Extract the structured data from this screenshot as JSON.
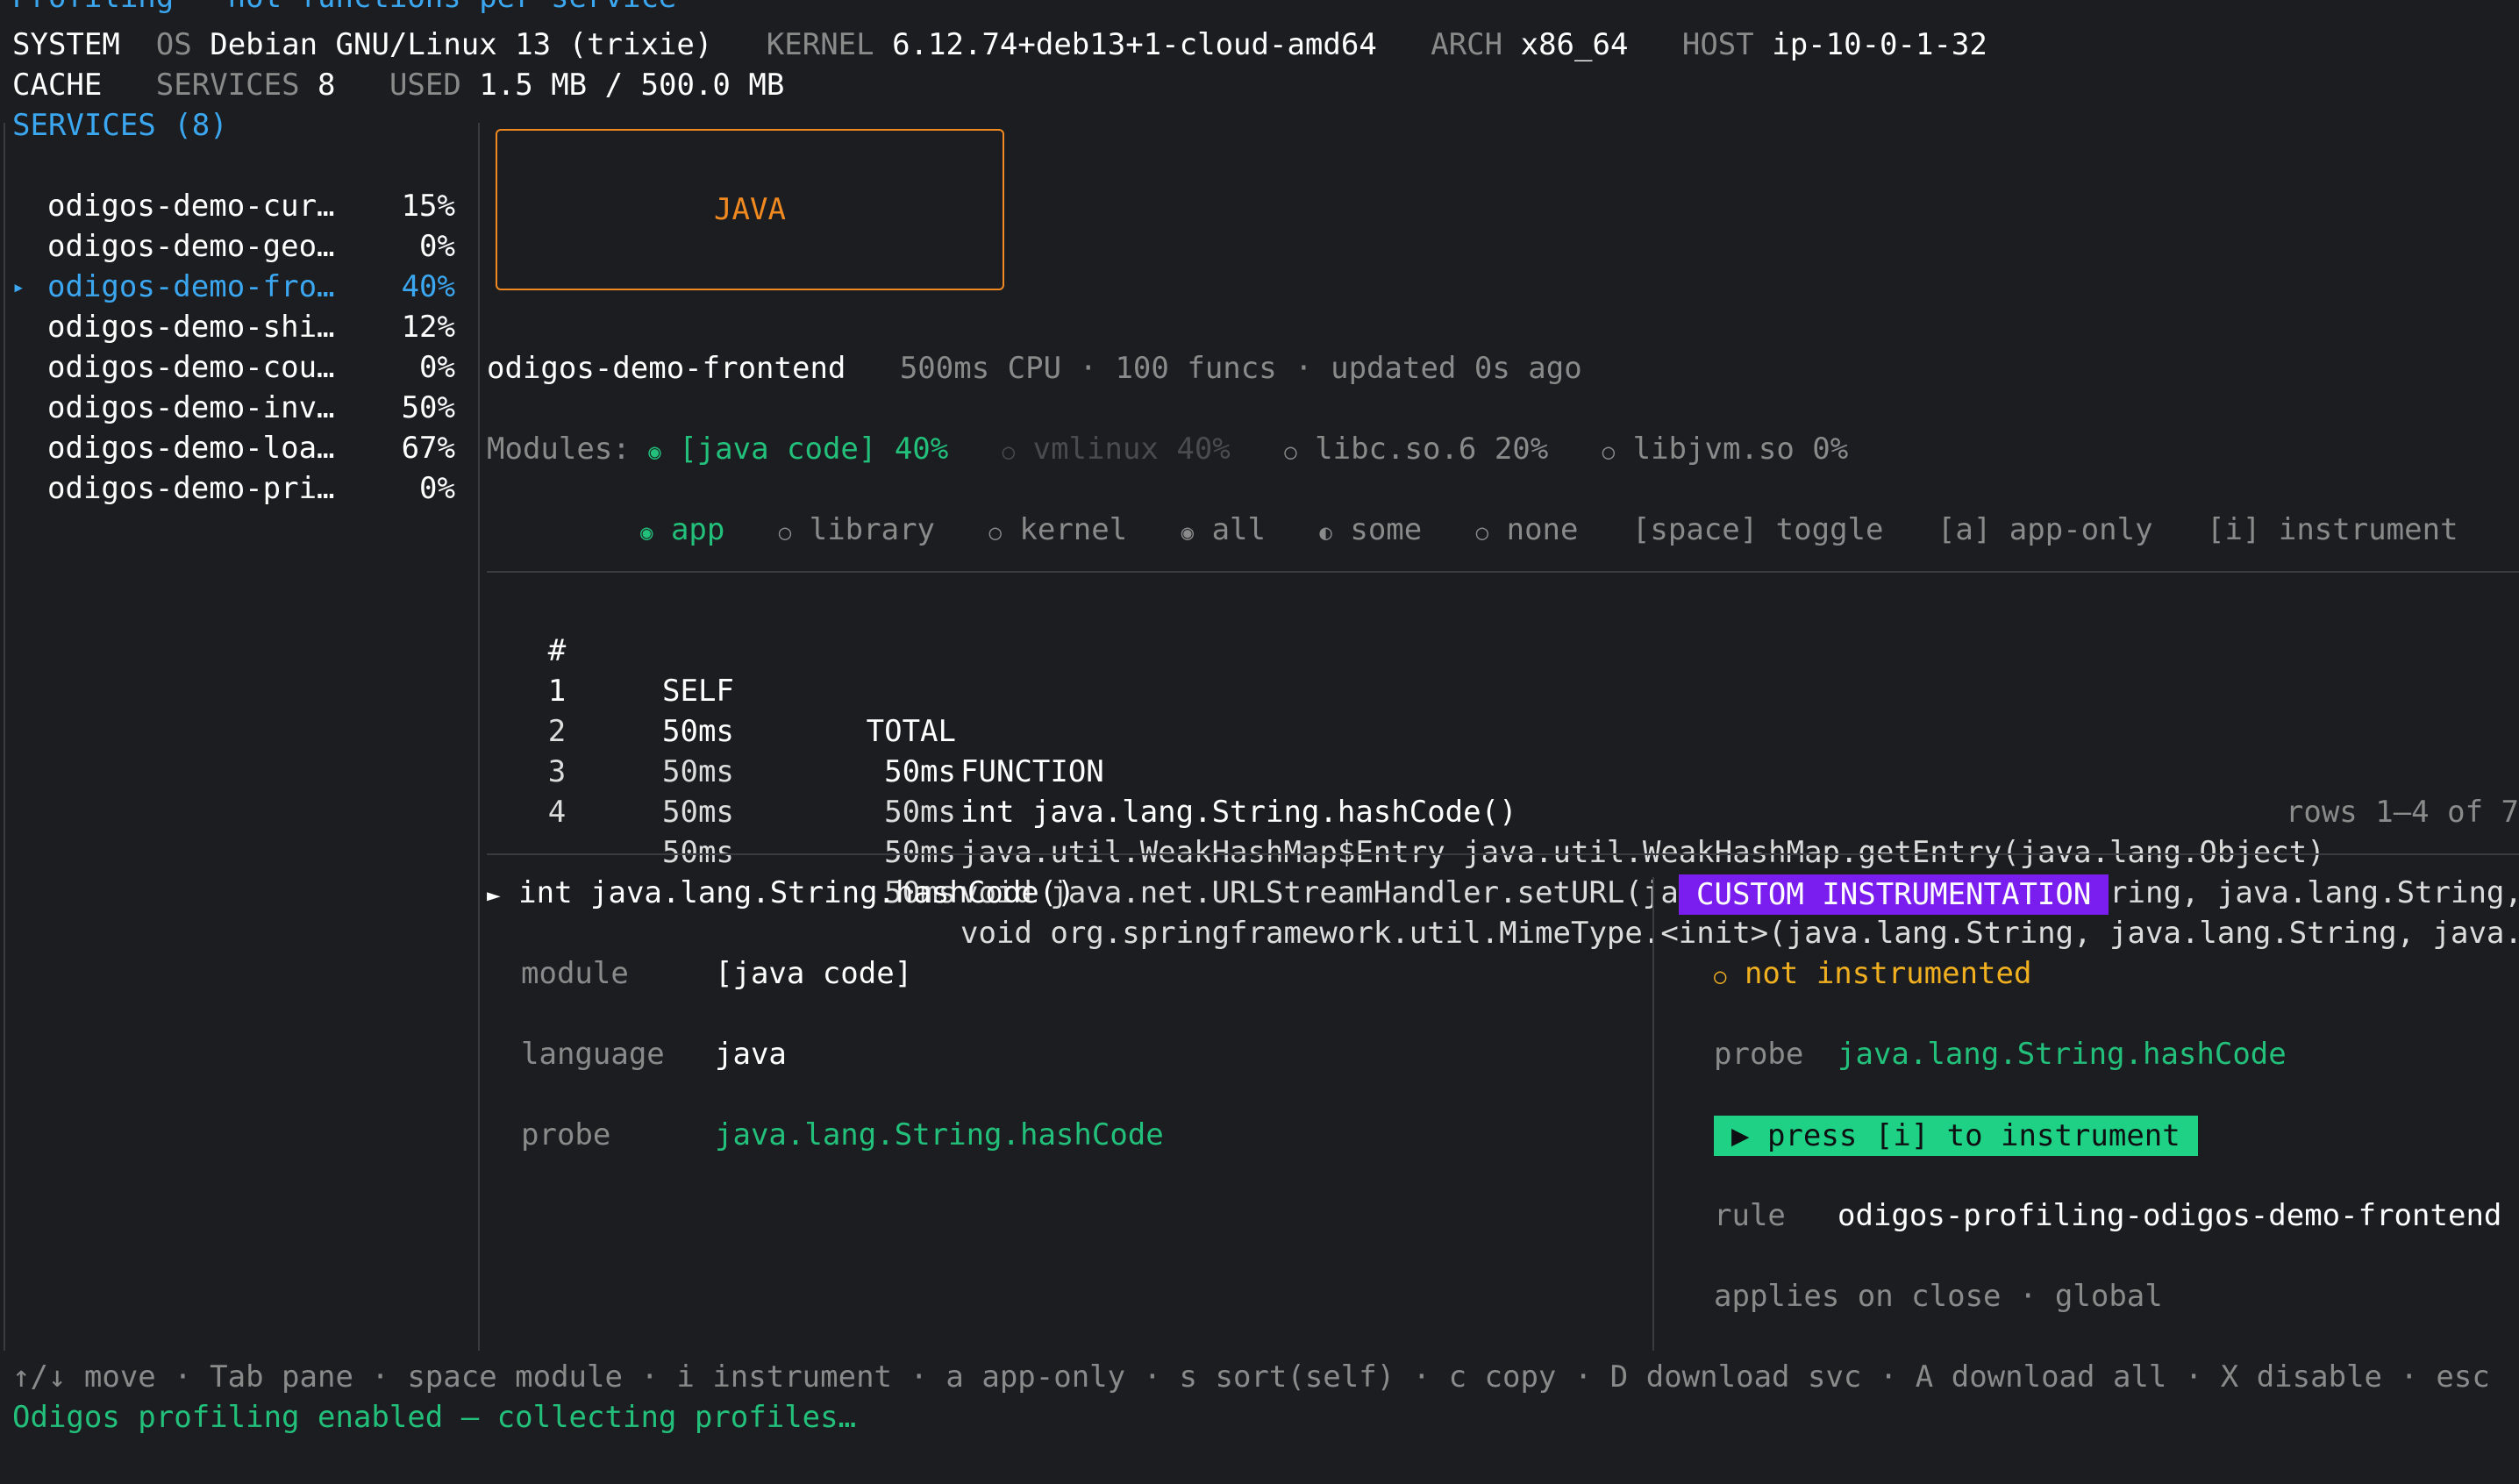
{
  "header": {
    "title_partial": "Profiling · hot functions per service",
    "system_label": "SYSTEM",
    "os_label": "OS",
    "os_value": "Debian GNU/Linux 13 (trixie)",
    "kernel_label": "KERNEL",
    "kernel_value": "6.12.74+deb13+1-cloud-amd64",
    "arch_label": "ARCH",
    "arch_value": "x86_64",
    "host_label": "HOST",
    "host_value": "ip-10-0-1-32",
    "cache_label": "CACHE",
    "services_label": "SERVICES",
    "services_value": "8",
    "used_label": "USED",
    "used_value": "1.5 MB / 500.0 MB"
  },
  "sidebar": {
    "title": "SERVICES (8)",
    "selected_marker": "▸",
    "items": [
      {
        "name": "odigos-demo-cur…",
        "pct": "15%"
      },
      {
        "name": "odigos-demo-geo…",
        "pct": "0%"
      },
      {
        "name": "odigos-demo-fro…",
        "pct": "40%"
      },
      {
        "name": "odigos-demo-shi…",
        "pct": "12%"
      },
      {
        "name": "odigos-demo-cou…",
        "pct": "0%"
      },
      {
        "name": "odigos-demo-inv…",
        "pct": "50%"
      },
      {
        "name": "odigos-demo-loa…",
        "pct": "67%"
      },
      {
        "name": "odigos-demo-pri…",
        "pct": "0%"
      }
    ]
  },
  "language_badge": "JAVA",
  "service": {
    "name": "odigos-demo-frontend",
    "meta": "500ms CPU · 100 funcs · updated 0s ago"
  },
  "modules": {
    "label": "Modules:",
    "items": [
      {
        "icon": "◉",
        "text": "[java code] 40%"
      },
      {
        "icon": "○",
        "text": "vmlinux 40%"
      },
      {
        "icon": "○",
        "text": "libc.so.6 20%"
      },
      {
        "icon": "○",
        "text": "libjvm.so 0%"
      }
    ]
  },
  "filters": {
    "app": {
      "icon": "◉",
      "label": "app"
    },
    "library": {
      "icon": "○",
      "label": "library"
    },
    "kernel": {
      "icon": "○",
      "label": "kernel"
    },
    "all": {
      "icon": "◉",
      "label": "all"
    },
    "some": {
      "icon": "◐",
      "label": "some"
    },
    "none": {
      "icon": "○",
      "label": "none"
    },
    "hint_toggle": "[space] toggle",
    "hint_app_only": "[a] app-only",
    "hint_instrument": "[i] instrument"
  },
  "table": {
    "headers": {
      "num": "#",
      "self": "SELF",
      "total": "TOTAL",
      "function": "FUNCTION"
    },
    "rows": [
      {
        "num": "1",
        "self": "50ms",
        "total": "50ms",
        "function": "int java.lang.String.hashCode()"
      },
      {
        "num": "2",
        "self": "50ms",
        "total": "50ms",
        "function": "java.util.WeakHashMap$Entry java.util.WeakHashMap.getEntry(java.lang.Object)"
      },
      {
        "num": "3",
        "self": "50ms",
        "total": "50ms",
        "function": "void java.net.URLStreamHandler.setURL(java.net.URL, java.lang.String, java.lang.String, …"
      },
      {
        "num": "4",
        "self": "50ms",
        "total": "50ms",
        "function": "void org.springframework.util.MimeType.<init>(java.lang.String, java.lang.String, java.u…"
      }
    ],
    "footer": "rows 1–4 of 7"
  },
  "detail": {
    "marker": "►",
    "title": "int java.lang.String.hashCode()",
    "module_label": "module",
    "module_value": "[java code]",
    "language_label": "language",
    "language_value": "java",
    "probe_label": "probe",
    "probe_value": "java.lang.String.hashCode"
  },
  "instrumentation": {
    "title": "CUSTOM INSTRUMENTATION",
    "status_icon": "○",
    "status": "not instrumented",
    "probe_label": "probe",
    "probe_value": "java.lang.String.hashCode",
    "button": "▶ press [i] to instrument",
    "rule_label": "rule",
    "rule_value": "odigos-profiling-odigos-demo-frontend",
    "applies": "applies on close · global"
  },
  "footer": {
    "keys": "↑/↓ move · Tab pane · space module · i instrument · a app-only · s sort(self) · c copy · D download svc · A download all · X disable · esc",
    "status": "Odigos profiling enabled — collecting profiles…"
  },
  "colors": {
    "background": "#1c1d21",
    "accent_blue": "#3ba7f0",
    "accent_green": "#22c07a",
    "accent_orange": "#f08a20",
    "accent_purple": "#7a1ef0",
    "warning_yellow": "#f0b020"
  }
}
